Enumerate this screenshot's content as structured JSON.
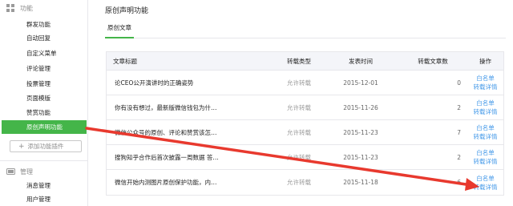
{
  "sidebar": {
    "section_function": "功能",
    "items": [
      {
        "label": "群发功能"
      },
      {
        "label": "自动回复"
      },
      {
        "label": "自定义菜单"
      },
      {
        "label": "评论管理"
      },
      {
        "label": "投票管理"
      },
      {
        "label": "页面模版"
      },
      {
        "label": "赞赏功能"
      },
      {
        "label": "原创声明功能"
      }
    ],
    "add_plugin": "添加功能插件",
    "section_manage": "管理",
    "manage_items": [
      {
        "label": "消息管理"
      },
      {
        "label": "用户管理"
      }
    ]
  },
  "main": {
    "title": "原创声明功能",
    "tab": "原创文章",
    "headers": {
      "title": "文章标题",
      "type": "转载类型",
      "time": "发表时间",
      "count": "转载文章数",
      "op": "操作"
    },
    "rows": [
      {
        "title": "论CEO公开演讲时的正确姿势",
        "type": "允许转载",
        "time": "2015-12-01",
        "count": "0",
        "op1": "白名单",
        "op2": "转载详情"
      },
      {
        "title": "你有没有想过，最新版微信钱包为什…",
        "type": "允许转载",
        "time": "2015-11-26",
        "count": "2",
        "op1": "白名单",
        "op2": "转载详情"
      },
      {
        "title": "微信公众号的原创、评论和赞赏该怎…",
        "type": "允许转载",
        "time": "2015-11-23",
        "count": "7",
        "op1": "白名单",
        "op2": "转载详情"
      },
      {
        "title": "搜狗知乎合作后首次披露一周数据 答…",
        "type": "允许转载",
        "time": "2015-11-23",
        "count": "2",
        "op1": "白名单",
        "op2": "转载详情"
      },
      {
        "title": "微信开始内测图片原创保护功能，内…",
        "type": "允许转载",
        "time": "2015-11-18",
        "count": "6",
        "op1": "白名单",
        "op2": "转载详情"
      }
    ]
  },
  "colors": {
    "accent_green": "#44b549",
    "link_blue": "#459ae9",
    "annotation_red": "#e8392e"
  },
  "icons": {
    "function": "grid-icon",
    "manage": "folder-icon",
    "add": "plus-icon"
  }
}
